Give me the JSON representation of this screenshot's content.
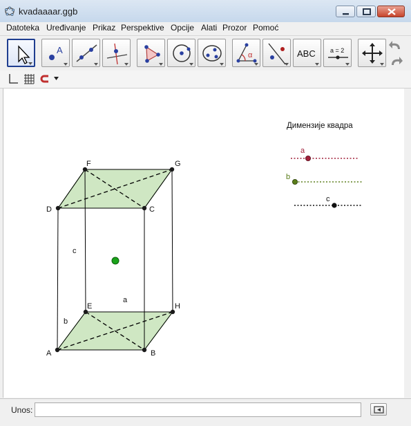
{
  "window": {
    "title": "kvadaaaar.ggb"
  },
  "menu": [
    "Datoteka",
    "Uređivanje",
    "Prikaz",
    "Perspektive",
    "Opcije",
    "Alati",
    "Prozor",
    "Pomoć"
  ],
  "toolbar": {
    "tools": [
      {
        "name": "move-tool",
        "icon": "arrow-pointer-icon"
      },
      {
        "name": "point-tool",
        "icon": "point-icon",
        "glyph": "A"
      },
      {
        "name": "line-tool",
        "icon": "line-through-points-icon"
      },
      {
        "name": "perpendicular-tool",
        "icon": "perpendicular-line-icon"
      },
      {
        "name": "polygon-tool",
        "icon": "polygon-icon"
      },
      {
        "name": "circle-tool",
        "icon": "circle-center-point-icon"
      },
      {
        "name": "ellipse-tool",
        "icon": "ellipse-icon"
      },
      {
        "name": "angle-tool",
        "icon": "angle-icon",
        "glyph": "α"
      },
      {
        "name": "reflect-tool",
        "icon": "reflect-icon"
      },
      {
        "name": "text-tool",
        "icon": "text-icon",
        "glyph": "ABC"
      },
      {
        "name": "slider-tool",
        "icon": "slider-icon",
        "glyph": "a = 2"
      },
      {
        "name": "move-view-tool",
        "icon": "move-graphics-view-icon"
      }
    ],
    "undo_icon": "undo-icon",
    "redo_icon": "redo-icon"
  },
  "stylebar": {
    "icons": [
      "axes-icon",
      "grid-icon",
      "magnet-snap-icon",
      "dropdown-arrow-icon"
    ]
  },
  "canvas": {
    "sliders_title": "Димензије квадра",
    "sliders": [
      {
        "label": "a",
        "color": "#a0203a"
      },
      {
        "label": "b",
        "color": "#5a7d1a"
      },
      {
        "label": "c",
        "color": "#111111"
      }
    ],
    "point_labels": {
      "A": "A",
      "B": "B",
      "D": "D",
      "C": "C",
      "E": "E",
      "H": "H",
      "F": "F",
      "G": "G"
    },
    "edge_labels": {
      "a": "a",
      "b": "b",
      "c": "c"
    },
    "colors": {
      "face_fill": "#cfe7c3",
      "face_stroke": "#2e6b1f",
      "center_point": "#1aa31a"
    }
  },
  "input_bar": {
    "label": "Unos:",
    "value": "",
    "keyboard_icon": "virtual-keyboard-icon"
  }
}
